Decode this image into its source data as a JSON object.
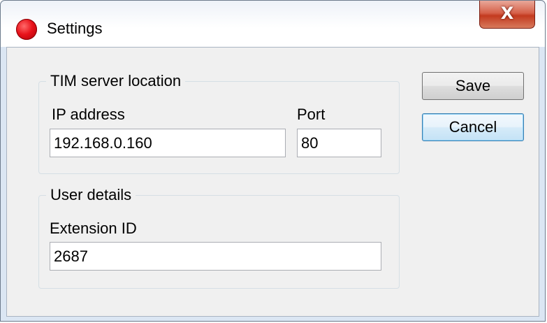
{
  "window": {
    "title": "Settings",
    "close_glyph": "X",
    "app_icon": "red-circle-icon"
  },
  "server_group": {
    "legend": "TIM server location",
    "ip_label": "IP address",
    "ip_value": "192.168.0.160",
    "port_label": "Port",
    "port_value": "80"
  },
  "user_group": {
    "legend": "User details",
    "extension_label": "Extension ID",
    "extension_value": "2687"
  },
  "buttons": {
    "save_label": "Save",
    "cancel_label": "Cancel"
  },
  "colors": {
    "app_icon": "#e8121a",
    "close_button": "#c33a1f",
    "default_button_border": "#3c7fb1"
  }
}
